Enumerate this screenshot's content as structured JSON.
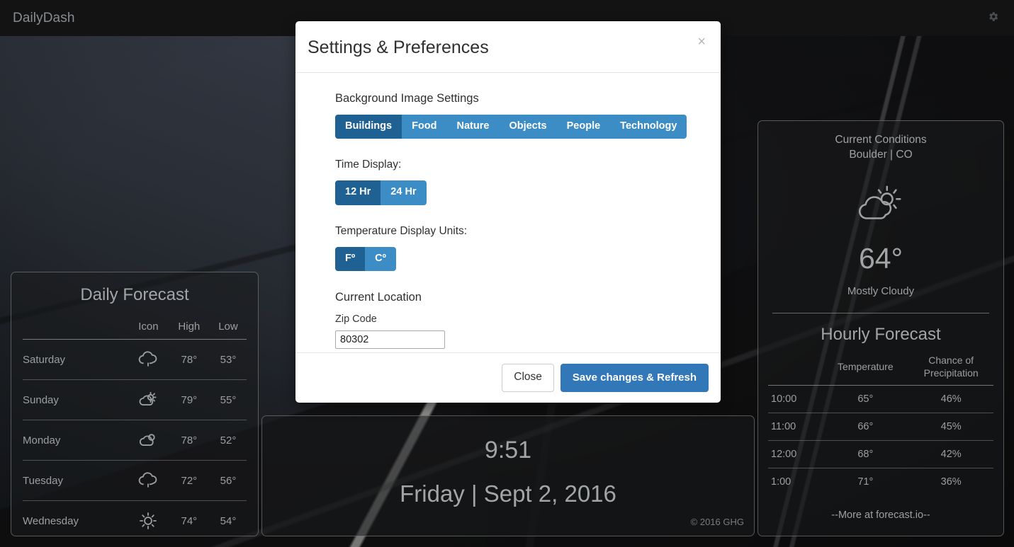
{
  "navbar": {
    "brand": "DailyDash",
    "settings_icon": "gear-icon"
  },
  "daily_forecast": {
    "title": "Daily Forecast",
    "columns": [
      "",
      "Icon",
      "High",
      "Low"
    ],
    "rows": [
      {
        "day": "Saturday",
        "icon": "cloud",
        "high": "78°",
        "low": "53°"
      },
      {
        "day": "Sunday",
        "icon": "partly-sunny",
        "high": "79°",
        "low": "55°"
      },
      {
        "day": "Monday",
        "icon": "partly-cloudy",
        "high": "78°",
        "low": "52°"
      },
      {
        "day": "Tuesday",
        "icon": "cloud",
        "high": "72°",
        "low": "56°"
      },
      {
        "day": "Wednesday",
        "icon": "sun",
        "high": "74°",
        "low": "54°"
      }
    ]
  },
  "clock": {
    "time": "9:51",
    "date": "Friday | Sept 2, 2016",
    "copyright": "© 2016 GHG"
  },
  "weather": {
    "current_heading_line1": "Current Conditions",
    "current_heading_line2": "Boulder | CO",
    "current_icon": "partly-cloudy-icon",
    "temperature": "64°",
    "summary": "Mostly Cloudy",
    "hourly_title": "Hourly Forecast",
    "hourly_columns": [
      "",
      "Temperature",
      "Chance of Precipitation"
    ],
    "hourly_col2_line1": "Chance of",
    "hourly_col2_line2": "Precipitation",
    "hourly_rows": [
      {
        "time": "10:00",
        "temp": "65°",
        "precip": "46%"
      },
      {
        "time": "11:00",
        "temp": "66°",
        "precip": "45%"
      },
      {
        "time": "12:00",
        "temp": "68°",
        "precip": "42%"
      },
      {
        "time": "1:00",
        "temp": "71°",
        "precip": "36%"
      }
    ],
    "more_link": "--More at forecast.io--"
  },
  "modal": {
    "title": "Settings & Preferences",
    "close_icon": "×",
    "background_section_label": "Background Image Settings",
    "background_categories": [
      {
        "label": "Buildings",
        "active": true
      },
      {
        "label": "Food",
        "active": false
      },
      {
        "label": "Nature",
        "active": false
      },
      {
        "label": "Objects",
        "active": false
      },
      {
        "label": "People",
        "active": false
      },
      {
        "label": "Technology",
        "active": false
      }
    ],
    "time_display_label": "Time Display:",
    "time_display_options": [
      {
        "label": "12 Hr",
        "active": true
      },
      {
        "label": "24 Hr",
        "active": false
      }
    ],
    "temp_units_label": "Temperature Display Units:",
    "temp_units_options": [
      {
        "label": "Fº",
        "active": true
      },
      {
        "label": "Cº",
        "active": false
      }
    ],
    "location_label": "Current Location",
    "zip_label": "Zip Code",
    "zip_value": "80302",
    "zip_placeholder": "Zip Code",
    "close_label": "Close",
    "save_label": "Save changes & Refresh"
  },
  "colors": {
    "accent_blue": "#3c8dc5",
    "accent_blue_active": "#1f6193",
    "save_blue": "#3278b8",
    "navbar_bg": "#161616",
    "panel_text": "#b1b4b7"
  }
}
